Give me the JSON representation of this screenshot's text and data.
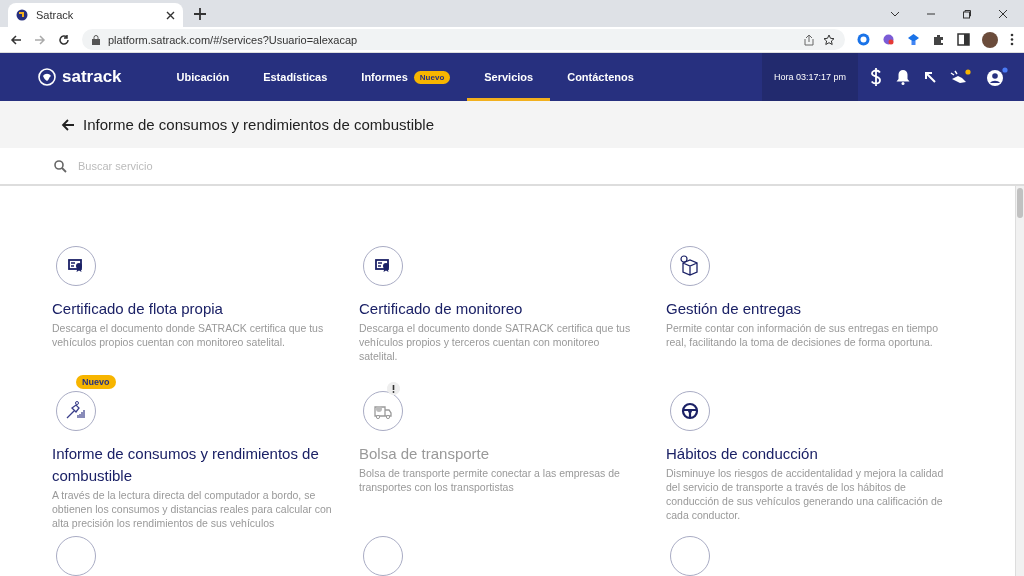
{
  "browser": {
    "tabs": [
      {
        "title": "Satrack",
        "selected": true
      }
    ],
    "url": "platform.satrack.com/#/services?Usuario=alexacap"
  },
  "navbar": {
    "brand": "satrack",
    "items": [
      {
        "label": "Ubicación",
        "selected": false
      },
      {
        "label": "Estadísticas",
        "selected": false
      },
      {
        "label": "Informes",
        "selected": false,
        "badge": "Nuevo"
      },
      {
        "label": "Servicios",
        "selected": true
      },
      {
        "label": "Contáctenos",
        "selected": false
      }
    ],
    "clock": "Hora 03:17:17 pm"
  },
  "page_title": "Informe de consumos y rendimientos de combustible",
  "search": {
    "placeholder": "Buscar servicio"
  },
  "services": [
    {
      "kind": "certificate",
      "title": "Certificado de flota propia",
      "description": "Descarga el documento donde SATRACK certifica que tus vehículos propios cuentan con monitoreo satelital.",
      "disabled": false
    },
    {
      "kind": "certificate",
      "title": "Certificado de monitoreo",
      "description": "Descarga el documento donde SATRACK certifica que tus vehículos propios y terceros cuentan con monitoreo satelital.",
      "disabled": false
    },
    {
      "kind": "box",
      "title": "Gestión de entregas",
      "description": "Permite contar con información de sus entregas en tiempo real, facilitando la toma de decisiones de forma oportuna.",
      "disabled": false
    },
    {
      "kind": "fuel",
      "title": "Informe de consumos y rendimientos de combustible",
      "description": "A través de la lectura directa del computador a bordo, se obtienen los consumos y distancias reales para calcular con alta precisión los rendimientos de sus vehículos",
      "disabled": false,
      "badge": "Nuevo"
    },
    {
      "kind": "truck",
      "title": "Bolsa de transporte",
      "description": "Bolsa de transporte permite conectar a las empresas de transportes con los transportistas",
      "disabled": true
    },
    {
      "kind": "wheel",
      "title": "Hábitos de conducción",
      "description": "Disminuye los riesgos de accidentalidad y mejora la calidad del servicio de transporte a través de los hábitos de conducción de sus vehículos generando una calificación de cada conductor.",
      "disabled": false
    },
    {
      "kind": "blank"
    },
    {
      "kind": "blank"
    },
    {
      "kind": "blank"
    }
  ]
}
